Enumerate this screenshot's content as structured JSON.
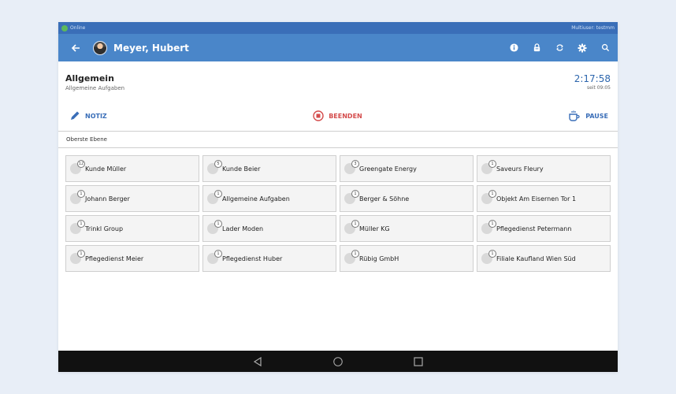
{
  "status_bar": {
    "connection": "Online",
    "user": "Multiuser: testmm"
  },
  "header": {
    "title": "Meyer, Hubert",
    "actions": [
      "info-icon",
      "lock-icon",
      "sync-icon",
      "gear-icon",
      "search-icon"
    ]
  },
  "task": {
    "title": "Allgemein",
    "subtitle": "Allgemeine Aufgaben",
    "timer": "2:17:58",
    "since": "seit 09:05"
  },
  "toolbar": {
    "note_label": "NOTIZ",
    "stop_label": "BEENDEN",
    "pause_label": "PAUSE"
  },
  "breadcrumb": "Oberste Ebene",
  "tiles": [
    {
      "label": "Kunde Müller",
      "count": "12"
    },
    {
      "label": "Kunde Beier",
      "count": "5"
    },
    {
      "label": "Greengate Energy",
      "count": "3"
    },
    {
      "label": "Saveurs Fleury",
      "count": "1"
    },
    {
      "label": "Johann Berger",
      "count": "1"
    },
    {
      "label": "Allgemeine Aufgaben",
      "count": "1"
    },
    {
      "label": "Berger & Söhne",
      "count": "1"
    },
    {
      "label": "Objekt Am Eisernen Tor 1",
      "count": "1"
    },
    {
      "label": "Trinkl Group",
      "count": "1"
    },
    {
      "label": "Lader Moden",
      "count": "1"
    },
    {
      "label": "Müller KG",
      "count": "1"
    },
    {
      "label": "Pflegedienst Petermann",
      "count": "1"
    },
    {
      "label": "Pflegedienst Meier",
      "count": "1"
    },
    {
      "label": "Pflegedienst Huber",
      "count": "1"
    },
    {
      "label": "Rübig GmbH",
      "count": "1"
    },
    {
      "label": "Filiale Kaufland Wien Süd",
      "count": "1"
    }
  ],
  "colors": {
    "header": "#4a86c9",
    "status_bar": "#3a6eb8",
    "accent_blue": "#3a6eb8",
    "stop_red": "#d44c4c"
  }
}
